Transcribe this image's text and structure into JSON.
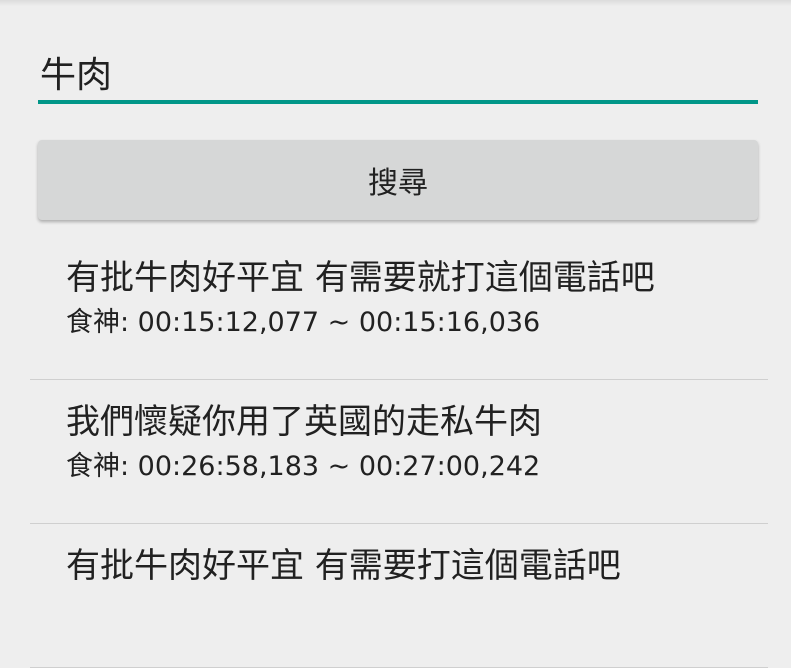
{
  "search": {
    "query": "牛肉",
    "button_label": "搜尋"
  },
  "colors": {
    "accent": "#009688",
    "background": "#eeeeee",
    "button": "#d6d7d7",
    "text": "#212121"
  },
  "results": [
    {
      "text": "有批牛肉好平宜 有需要就打這個電話吧",
      "meta": "食神: 00:15:12,077 ~ 00:15:16,036"
    },
    {
      "text": "我們懷疑你用了英國的走私牛肉",
      "meta": "食神: 00:26:58,183 ~ 00:27:00,242"
    },
    {
      "text": "有批牛肉好平宜 有需要打這個電話吧",
      "meta": ""
    }
  ]
}
